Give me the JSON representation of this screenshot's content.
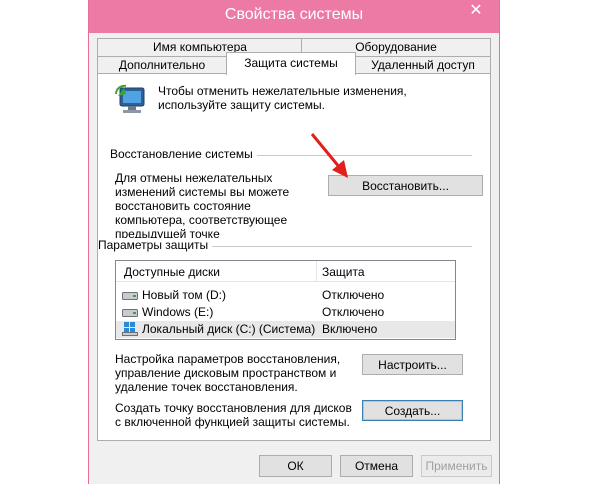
{
  "window": {
    "title": "Свойства системы",
    "close_glyph": "✕"
  },
  "tabs": {
    "computer_name": "Имя компьютера",
    "hardware": "Оборудование",
    "advanced": "Дополнительно",
    "protection": "Защита системы",
    "remote": "Удаленный доступ"
  },
  "intro": {
    "text": "Чтобы отменить нежелательные изменения, используйте защиту системы.",
    "icon": "system-protection-icon"
  },
  "restore": {
    "group_title": "Восстановление системы",
    "description": "Для отмены нежелательных изменений системы вы можете восстановить состояние компьютера, соответствующее предыдущей точке восстановления.",
    "button": "Восстановить..."
  },
  "protection": {
    "group_title": "Параметры защиты",
    "columns": {
      "drives": "Доступные диски",
      "protection": "Защита"
    },
    "rows": [
      {
        "name": "Новый том (D:)",
        "status": "Отключено",
        "icon": "drive-icon"
      },
      {
        "name": "Windows (E:)",
        "status": "Отключено",
        "icon": "drive-icon"
      },
      {
        "name": "Локальный диск (C:) (Система)",
        "status": "Включено",
        "icon": "system-drive-icon"
      }
    ],
    "configure_text": "Настройка параметров восстановления, управление дисковым пространством и удаление точек восстановления.",
    "configure_button": "Настроить...",
    "create_text": "Создать точку восстановления для дисков с включенной функцией защиты системы.",
    "create_button": "Создать..."
  },
  "footer": {
    "ok": "ОК",
    "cancel": "Отмена",
    "apply": "Применить"
  },
  "colors": {
    "titlebar": "#ed7aa5",
    "arrow": "#e0201c",
    "accent_border": "#3c7fb1"
  }
}
